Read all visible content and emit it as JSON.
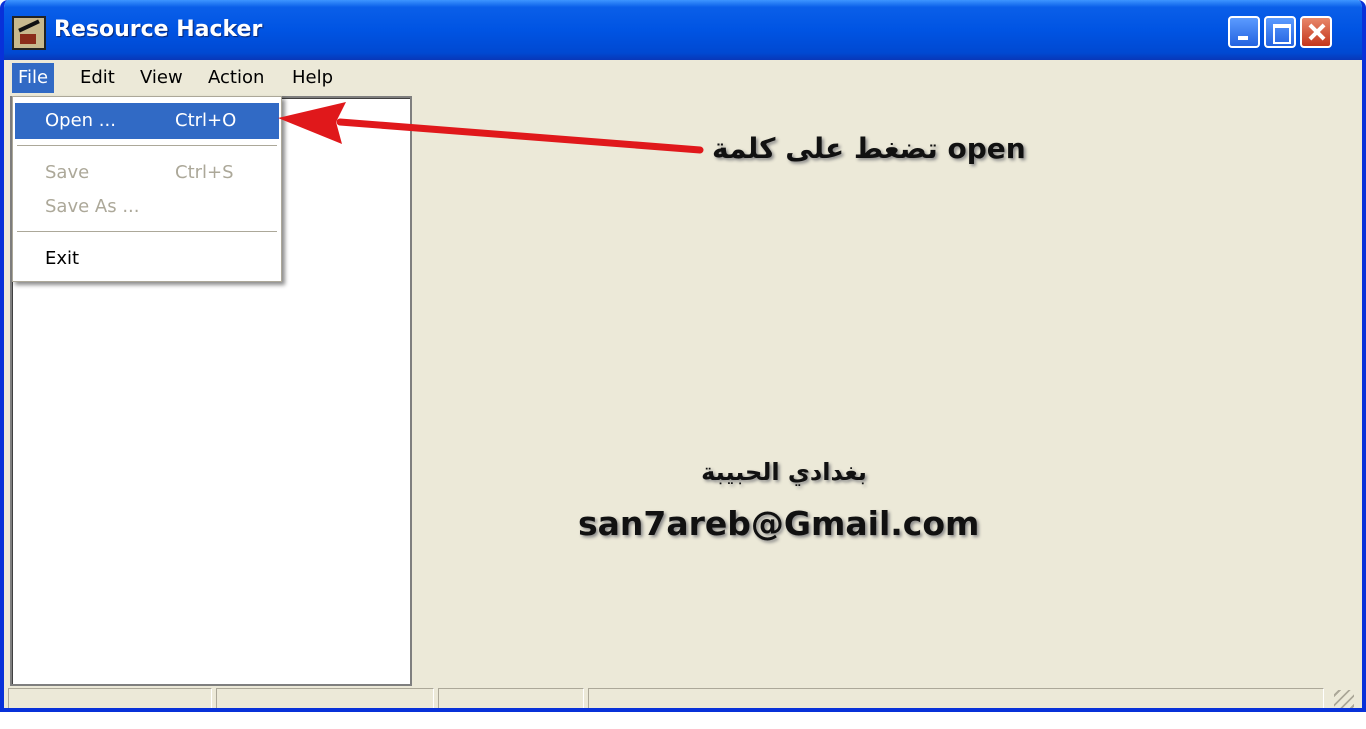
{
  "window": {
    "title": "Resource Hacker"
  },
  "menubar": {
    "file": "File",
    "edit": "Edit",
    "view": "View",
    "action": "Action",
    "help": "Help"
  },
  "file_menu": {
    "open_label": "Open ...",
    "open_shortcut": "Ctrl+O",
    "save_label": "Save",
    "save_shortcut": "Ctrl+S",
    "save_as_label": "Save As ...",
    "exit_label": "Exit"
  },
  "annotations": {
    "open_instruction": "تضغط على كلمة open",
    "signature": "بغدادي الحبيبة",
    "email": "san7areb@Gmail.com"
  },
  "colors": {
    "titlebar": "#0054e3",
    "menu_highlight": "#316ac5",
    "arrow": "#e0181b"
  }
}
